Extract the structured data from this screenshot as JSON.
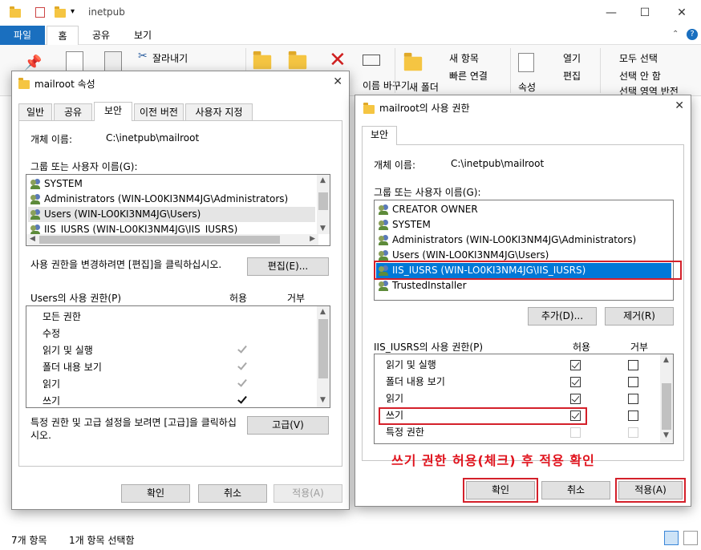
{
  "explorer": {
    "title": "inetpub",
    "tabs": {
      "file": "파일",
      "home": "홈",
      "share": "공유",
      "view": "보기"
    },
    "ribbon": {
      "cut": "잘라내기",
      "rename": "이름 바꾸기",
      "new_item": "새 항목",
      "easy_access": "빠른 연결",
      "new_folder": "새 폴더",
      "properties": "속성",
      "open": "열기",
      "edit": "편집",
      "select_all": "모두 선택",
      "select_none": "선택 안 함",
      "invert_selection": "선택 영역 반전"
    },
    "status": {
      "count": "7개 항목",
      "selected": "1개 항목 선택함"
    }
  },
  "props": {
    "title": "mailroot 속성",
    "tabs": [
      "일반",
      "공유",
      "보안",
      "이전 버전",
      "사용자 지정"
    ],
    "object_label": "개체 이름:",
    "object_name": "C:\\inetpub\\mailroot",
    "groups_label": "그룹 또는 사용자 이름(G):",
    "users": [
      "SYSTEM",
      "Administrators (WIN-LO0KI3NM4JG\\Administrators)",
      "Users (WIN-LO0KI3NM4JG\\Users)",
      "IIS_IUSRS (WIN-LO0KI3NM4JG\\IIS_IUSRS)"
    ],
    "edit_hint": "사용 권한을 변경하려면 [편집]을 클릭하십시오.",
    "edit_button": "편집(E)...",
    "perm_label": "Users의 사용 권한(P)",
    "allow": "허용",
    "deny": "거부",
    "perms": [
      "모든 권한",
      "수정",
      "읽기 및 실행",
      "폴더 내용 보기",
      "읽기",
      "쓰기"
    ],
    "adv_hint": "특정 권한 및 고급 설정을 보려면 [고급]을 클릭하십시오.",
    "adv_button": "고급(V)",
    "ok": "확인",
    "cancel": "취소",
    "apply": "적용(A)"
  },
  "perm_dialog": {
    "title": "mailroot의 사용 권한",
    "tab": "보안",
    "object_label": "개체 이름:",
    "object_name": "C:\\inetpub\\mailroot",
    "groups_label": "그룹 또는 사용자 이름(G):",
    "users": [
      "CREATOR OWNER",
      "SYSTEM",
      "Administrators (WIN-LO0KI3NM4JG\\Administrators)",
      "Users (WIN-LO0KI3NM4JG\\Users)",
      "IIS_IUSRS (WIN-LO0KI3NM4JG\\IIS_IUSRS)",
      "TrustedInstaller"
    ],
    "add_button": "추가(D)...",
    "remove_button": "제거(R)",
    "perm_label": "IIS_IUSRS의 사용 권한(P)",
    "allow": "허용",
    "deny": "거부",
    "perms": [
      "읽기 및 실행",
      "폴더 내용 보기",
      "읽기",
      "쓰기",
      "특정 권한"
    ],
    "allow_checked": [
      true,
      true,
      true,
      true,
      false
    ],
    "deny_checked": [
      false,
      false,
      false,
      false,
      false
    ],
    "annotation": "쓰기 권한 허용(체크) 후 적용 확인",
    "ok": "확인",
    "cancel": "취소",
    "apply": "적용(A)"
  },
  "colors": {
    "accent": "#0078d7",
    "file_tab": "#1a6fbf",
    "annotation_red": "#e0131d"
  }
}
